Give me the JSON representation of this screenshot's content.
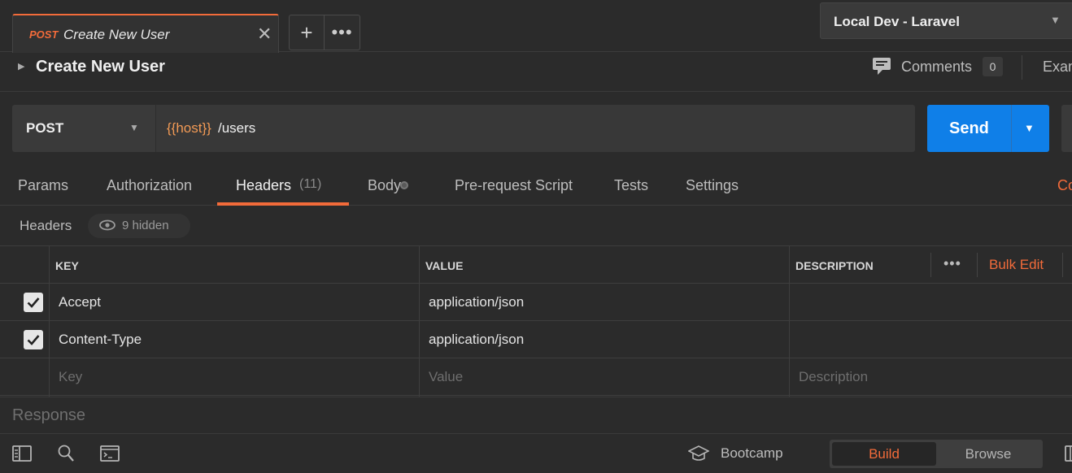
{
  "tab": {
    "method": "POST",
    "title": "Create New User",
    "close": "✕",
    "new": "+",
    "more": "•••"
  },
  "environment": {
    "selected": "Local Dev - Laravel"
  },
  "request": {
    "title": "Create New User",
    "comments_label": "Comments",
    "comments_count": "0",
    "examples_label": "Examples",
    "method": "POST",
    "url_variable": "{{host}}",
    "url_path": "/users",
    "send_label": "Send"
  },
  "tabs": [
    {
      "label": "Params"
    },
    {
      "label": "Authorization"
    },
    {
      "label": "Headers",
      "count": "(11)"
    },
    {
      "label": "Body"
    },
    {
      "label": "Pre-request Script"
    },
    {
      "label": "Tests"
    },
    {
      "label": "Settings"
    }
  ],
  "cookies_label": "Cookies",
  "headers_section": {
    "heading": "Headers",
    "hidden_label": "9 hidden"
  },
  "table": {
    "columns": {
      "key": "KEY",
      "value": "VALUE",
      "description": "DESCRIPTION"
    },
    "more": "•••",
    "bulk_edit": "Bulk Edit",
    "rows": [
      {
        "checked": true,
        "key": "Accept",
        "value": "application/json",
        "description": ""
      },
      {
        "checked": true,
        "key": "Content-Type",
        "value": "application/json",
        "description": ""
      }
    ],
    "placeholders": {
      "key": "Key",
      "value": "Value",
      "description": "Description"
    }
  },
  "response": {
    "label": "Response"
  },
  "status_bar": {
    "icons": [
      "sidebar-icon",
      "find-icon",
      "console-icon",
      "bootcamp-icon",
      "layout-icon"
    ],
    "bootcamp_label": "Bootcamp",
    "build_label": "Build",
    "browse_label": "Browse"
  },
  "colors": {
    "accent": "#f26b3a",
    "send": "#0f7fe8",
    "background": "#2b2b2b"
  }
}
